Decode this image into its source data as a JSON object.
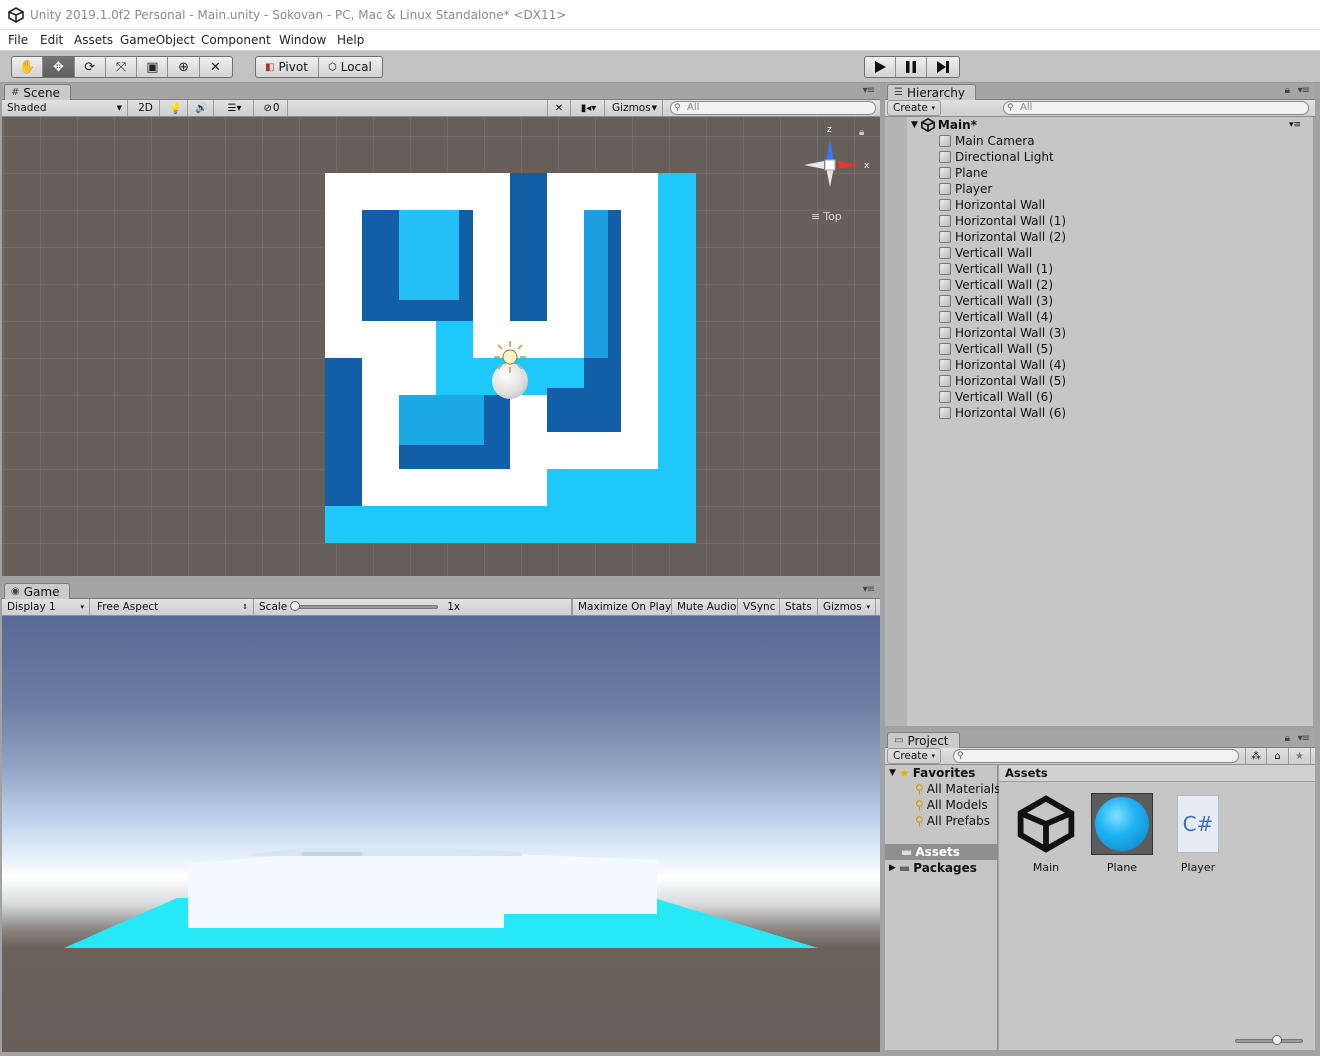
{
  "window": {
    "title": "Unity 2019.1.0f2 Personal - Main.unity - Sokovan - PC, Mac & Linux Standalone* <DX11>"
  },
  "menu": [
    "File",
    "Edit",
    "Assets",
    "GameObject",
    "Component",
    "Window",
    "Help"
  ],
  "toolbar": {
    "tools": [
      "hand-tool",
      "move-tool",
      "rotate-tool",
      "scale-tool",
      "rect-tool",
      "transform-tool",
      "custom-tool"
    ],
    "active_tool": "move-tool",
    "pivot_label": "Pivot",
    "local_label": "Local",
    "playback": [
      "play",
      "pause",
      "step"
    ]
  },
  "scene": {
    "tab_label": "Scene",
    "shading_mode": "Shaded",
    "mode_2d_label": "2D",
    "hidden_count": "0",
    "gizmos_label": "Gizmos",
    "search_placeholder": "All",
    "view_axis_label": "Top",
    "axis_z": "z",
    "axis_x": "x"
  },
  "game": {
    "tab_label": "Game",
    "display": "Display 1",
    "aspect": "Free Aspect",
    "scale_label": "Scale",
    "scale_value": "1x",
    "maximize_label": "Maximize On Play",
    "mute_label": "Mute Audio",
    "vsync_label": "VSync",
    "stats_label": "Stats",
    "gizmos_label": "Gizmos"
  },
  "hierarchy": {
    "tab_label": "Hierarchy",
    "create_label": "Create",
    "search_placeholder": "All",
    "scene_name": "Main*",
    "items": [
      "Main Camera",
      "Directional Light",
      "Plane",
      "Player",
      "Horizontal Wall",
      "Horizontal Wall (1)",
      "Horizontal Wall (2)",
      "Verticall Wall",
      "Verticall Wall (1)",
      "Verticall Wall (2)",
      "Verticall Wall (3)",
      "Verticall Wall (4)",
      "Horizontal Wall (3)",
      "Verticall Wall (5)",
      "Horizontal Wall (4)",
      "Horizontal Wall (5)",
      "Verticall Wall (6)",
      "Horizontal Wall (6)"
    ]
  },
  "project": {
    "tab_label": "Project",
    "create_label": "Create",
    "favorites_label": "Favorites",
    "favorites": [
      "All Materials",
      "All Models",
      "All Prefabs"
    ],
    "assets_folder_label": "Assets",
    "packages_label": "Packages",
    "breadcrumb": "Assets",
    "assets": [
      {
        "name": "Main",
        "icon": "unity-scene-icon"
      },
      {
        "name": "Plane",
        "icon": "material-sphere-icon"
      },
      {
        "name": "Player",
        "icon": "csharp-script-icon"
      }
    ],
    "csharp_glyph": "C#"
  },
  "colors": {
    "plane_blue": "#1fc8fb",
    "wall_shadow": "#135fa7",
    "wall_white": "#ffffff",
    "scene_background": "#67605a",
    "editor_gray": "#c6c6c6"
  }
}
